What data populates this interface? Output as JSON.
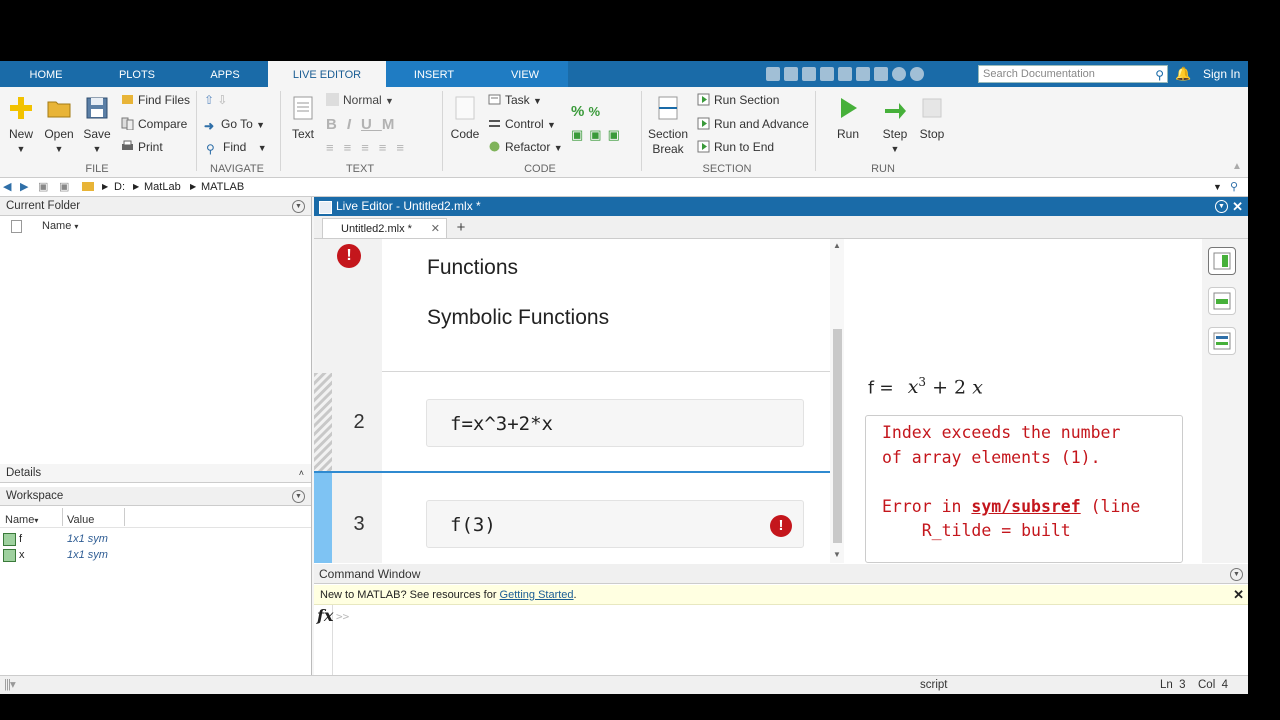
{
  "tabs": [
    "HOME",
    "PLOTS",
    "APPS",
    "LIVE EDITOR",
    "INSERT",
    "VIEW"
  ],
  "search": {
    "placeholder": "Search Documentation"
  },
  "sign_in": "Sign In",
  "ribbon": {
    "file": {
      "new": "New",
      "open": "Open",
      "save": "Save",
      "find_files": "Find Files",
      "compare": "Compare",
      "print": "Print",
      "label": "FILE"
    },
    "navigate": {
      "go_to": "Go To",
      "find": "Find",
      "label": "NAVIGATE"
    },
    "text": {
      "style": "Normal",
      "text": "Text",
      "label": "TEXT"
    },
    "code": {
      "code": "Code",
      "task": "Task",
      "control": "Control",
      "refactor": "Refactor",
      "label": "CODE"
    },
    "section": {
      "section_break": "Section\nBreak",
      "run_section": "Run Section",
      "run_advance": "Run and Advance",
      "run_end": "Run to End",
      "label": "SECTION"
    },
    "run": {
      "run": "Run",
      "step": "Step",
      "stop": "Stop",
      "label": "RUN"
    }
  },
  "address": {
    "drive": "D:",
    "folder1": "MatLab",
    "folder2": "MATLAB"
  },
  "current_folder": {
    "title": "Current Folder",
    "col_name": "Name"
  },
  "details": {
    "title": "Details"
  },
  "workspace": {
    "title": "Workspace",
    "col_name": "Name",
    "col_value": "Value",
    "rows": [
      {
        "name": "f",
        "value": "1x1 sym"
      },
      {
        "name": "x",
        "value": "1x1 sym"
      }
    ]
  },
  "editor": {
    "title": "Live Editor - Untitled2.mlx *",
    "tab": "Untitled2.mlx *",
    "heading1": "Functions",
    "heading2": "Symbolic Functions",
    "line2_no": "2",
    "line2_code": "f=x^3+2*x",
    "line3_no": "3",
    "line3_code": "f(3)"
  },
  "output": {
    "eq_lhs": "f =",
    "eq_x": "x",
    "eq_exp": "3",
    "eq_plus": "+ 2",
    "eq_x2": "x",
    "err_line1": "Index exceeds the number",
    "err_line2": "of array elements (1).",
    "err_prefix": "Error in ",
    "err_link": "sym/subsref",
    "err_suffix": " (line ",
    "err_line4": "    R_tilde = built"
  },
  "command_window": {
    "title": "Command Window",
    "banner_text": "New to MATLAB? See resources for ",
    "banner_link": "Getting Started",
    "banner_end": ".",
    "prompt": ">>"
  },
  "status": {
    "mode": "script",
    "ln": "Ln  3",
    "col": "Col  4"
  }
}
